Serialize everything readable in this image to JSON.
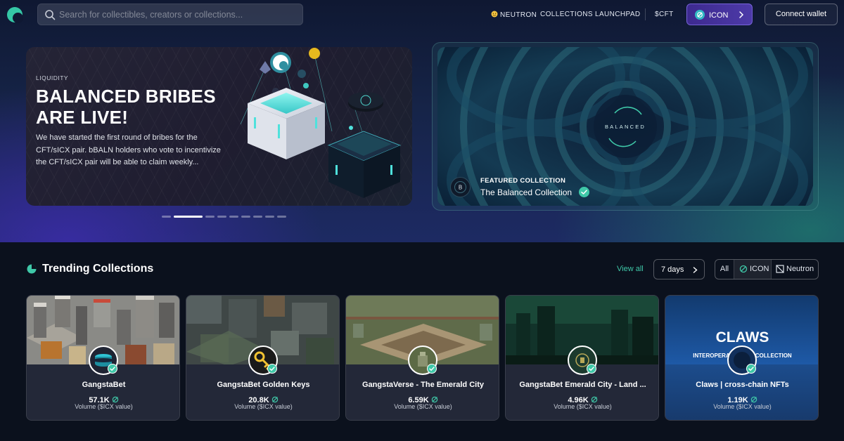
{
  "colors": {
    "accent": "#3fc8a8",
    "icon_purple": "#4d3aa8",
    "page_bg": "#0b111d"
  },
  "navbar": {
    "search_placeholder": "Search for collectibles, creators or collections...",
    "links": [
      {
        "label": "NEUTRON",
        "icon": "neutron-emoji-icon"
      },
      {
        "label": "COLLECTIONS"
      },
      {
        "label": "LAUNCHPAD"
      },
      {
        "label": "$CFT"
      }
    ],
    "network_button": "ICON",
    "connect_label": "Connect wallet"
  },
  "hero": {
    "eyebrow": "LIQUIDITY",
    "title": "BALANCED BRIBES ARE LIVE!",
    "description": "We have started the first round of bribes for the CFT/sICX pair. bBALN holders who vote to incentivize the CFT/sICX pair will be able to claim weekly...",
    "slide_count": 9,
    "active_slide": 2
  },
  "featured": {
    "eyebrow": "FEATURED COLLECTION",
    "name": "The Balanced Collection",
    "art_text": "BALANCED",
    "avatar_letter": "B"
  },
  "trending": {
    "title": "Trending Collections",
    "view_all": "View all",
    "period": "7 days",
    "filters": [
      {
        "label": "All"
      },
      {
        "label": "ICON",
        "icon": "icon-chain-icon"
      },
      {
        "label": "Neutron",
        "icon": "neutron-chain-icon"
      }
    ],
    "active_filter": "ICON",
    "volume_label": "Volume ($ICX value)",
    "collections": [
      {
        "name": "GangstaBet",
        "volume": "57.1K"
      },
      {
        "name": "GangstaBet Golden Keys",
        "volume": "20.8K"
      },
      {
        "name": "GangstaVerse - The Emerald City",
        "volume": "6.59K"
      },
      {
        "name": "GangstaBet Emerald City - Land ...",
        "volume": "4.96K"
      },
      {
        "name": "Claws | cross-chain NFTs",
        "volume": "1.19K",
        "banner_title": "CLAWS",
        "banner_subtitle": "INTEROPERABLE NFT COLLECTION"
      }
    ]
  }
}
